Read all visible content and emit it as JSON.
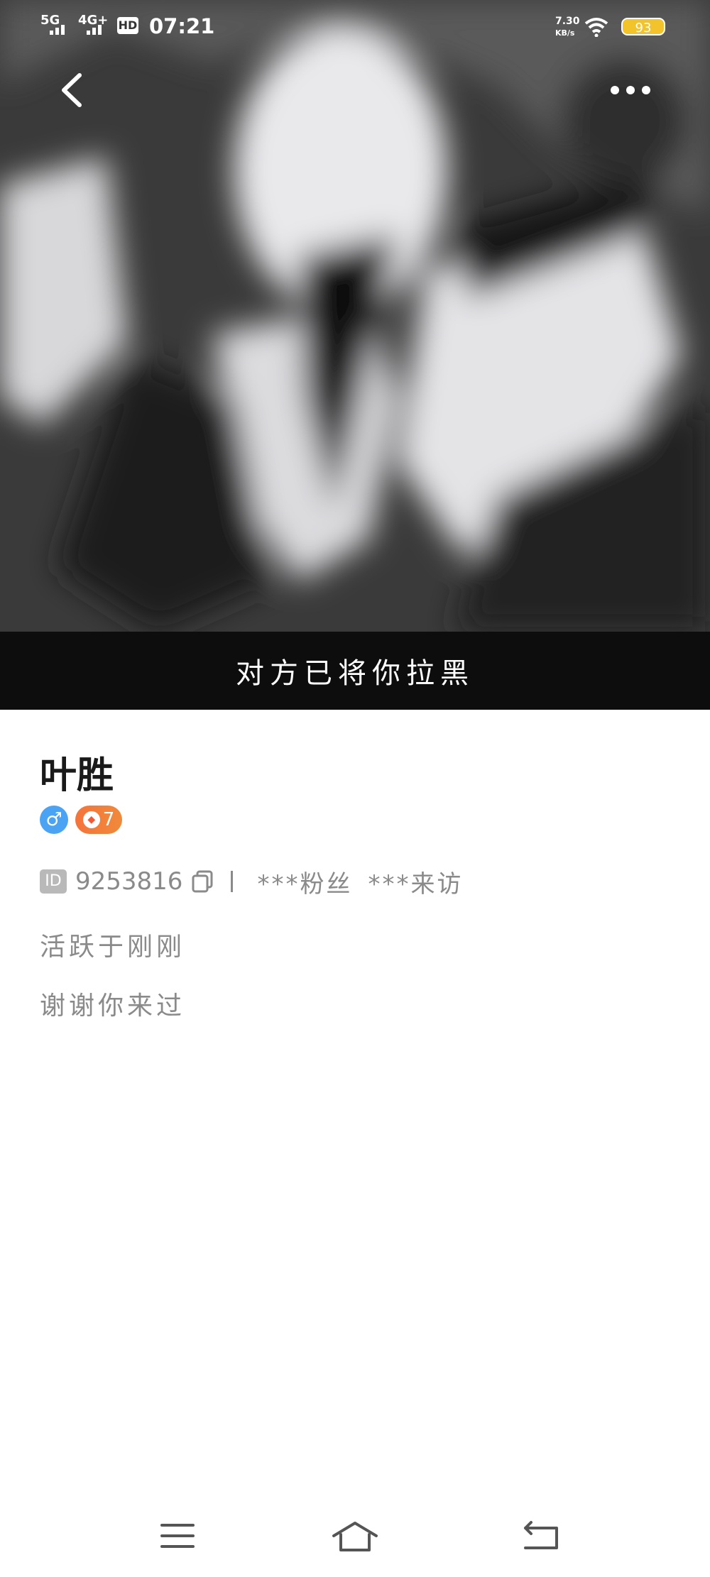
{
  "status_bar": {
    "network1": "5G",
    "network2": "4G+",
    "hd": "HD",
    "time": "07:21",
    "speed_value": "7.30",
    "speed_unit": "KB/s",
    "battery": "93"
  },
  "hero": {
    "blocked_notice": "对方已将你拉黑"
  },
  "profile": {
    "name": "叶胜",
    "gender_symbol": "♂",
    "level": "7",
    "id_tag": "ID",
    "id_number": "9253816",
    "fans": "***粉丝",
    "visits": "***来访",
    "active_status": "活跃于刚刚",
    "signature": "谢谢你来过"
  },
  "colors": {
    "accent_blue": "#4aa3f3",
    "level_orange": "#f4743b",
    "battery_yellow": "#f2c32a"
  },
  "icons": [
    "back-arrow-icon",
    "more-dots-icon",
    "copy-icon",
    "menu-icon",
    "home-icon",
    "return-icon"
  ]
}
